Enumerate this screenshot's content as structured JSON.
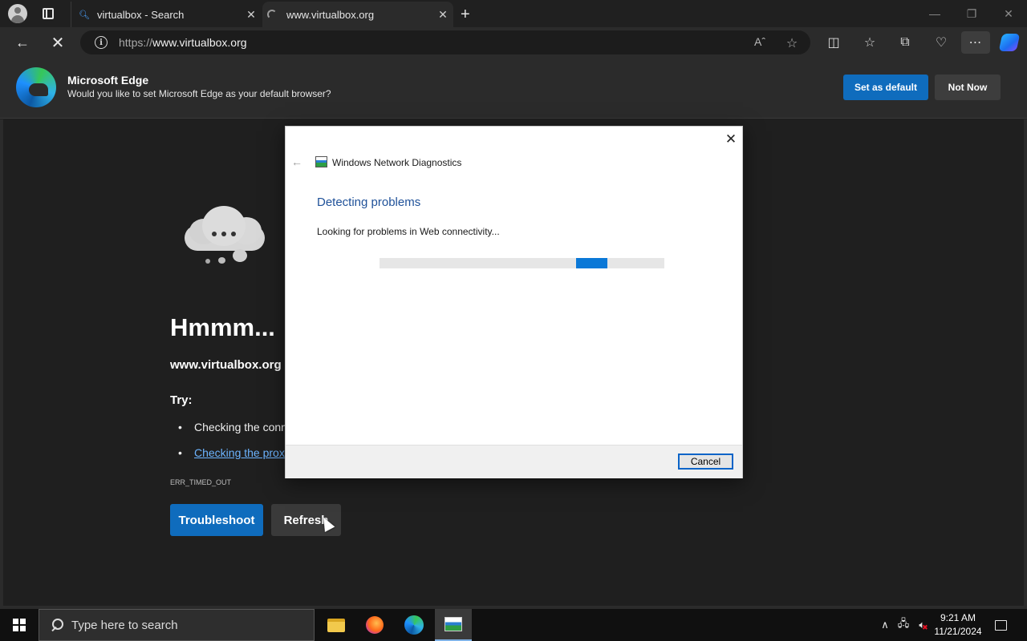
{
  "browser": {
    "tabs": [
      {
        "title": "virtualbox - Search"
      },
      {
        "title": "www.virtualbox.org"
      }
    ],
    "url_protocol": "https://",
    "url_host": "www.virtualbox.org",
    "icons": {
      "profile": "profile-avatar-icon",
      "tab_actions": "tab-actions-icon",
      "back": "back-arrow-icon",
      "stop": "stop-loading-icon",
      "site_info": "site-info-icon",
      "read_aloud": "read-aloud-icon",
      "favorite": "star-icon",
      "split_screen": "split-screen-icon",
      "favorites": "favorites-icon",
      "collections": "collections-icon",
      "performance": "browser-essentials-icon",
      "more": "more-icon",
      "copilot": "copilot-icon"
    }
  },
  "banner": {
    "title": "Microsoft Edge",
    "message": "Would you like to set Microsoft Edge as your default browser?",
    "set_default_label": "Set as default",
    "not_now_label": "Not Now"
  },
  "error_page": {
    "heading": "Hmmm...",
    "host": "www.virtualbox.org",
    "try_label": "Try:",
    "suggestions": [
      {
        "text": "Checking the conn"
      },
      {
        "text": "Checking the prox"
      }
    ],
    "error_code": "ERR_TIMED_OUT",
    "troubleshoot_label": "Troubleshoot",
    "refresh_label": "Refresh"
  },
  "dialog": {
    "title": "Windows Network Diagnostics",
    "heading": "Detecting problems",
    "status": "Looking for problems in Web connectivity...",
    "progress_indeterminate": true,
    "progress_segment_start": 0.69,
    "progress_segment_width": 0.11,
    "cancel_label": "Cancel"
  },
  "taskbar": {
    "search_placeholder": "Type here to search",
    "apps": [
      "File Explorer",
      "Firefox",
      "Microsoft Edge",
      "Windows Network Diagnostics"
    ],
    "time": "9:21 AM",
    "date": "11/21/2024"
  },
  "colors": {
    "accent_blue": "#0f6cbd",
    "dialog_heading": "#1f5199",
    "progress": "#0a78d7",
    "link": "#6cb4ff"
  }
}
